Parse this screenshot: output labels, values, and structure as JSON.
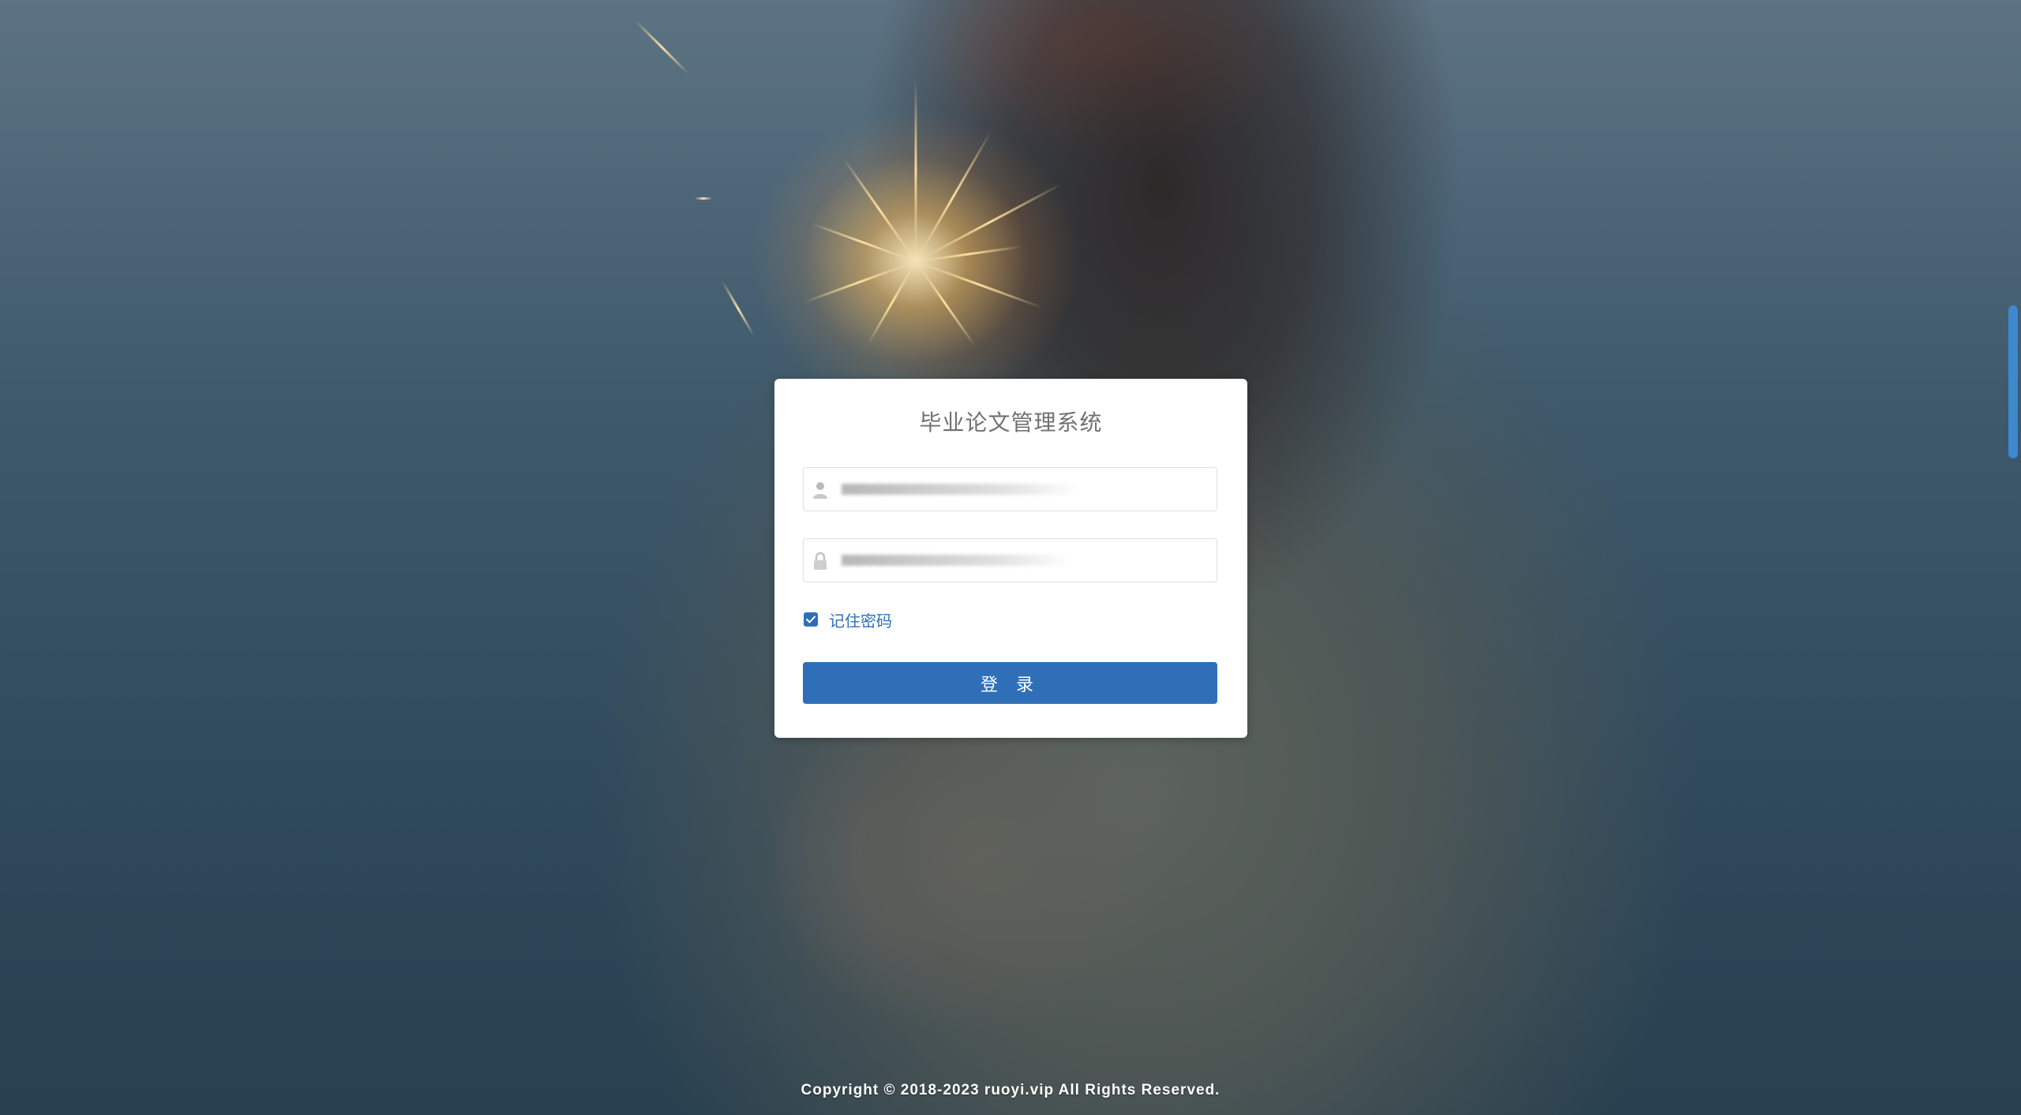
{
  "login": {
    "title": "毕业论文管理系统",
    "username": {
      "value": "",
      "placeholder": ""
    },
    "password": {
      "value": "",
      "placeholder": ""
    },
    "remember_checked": true,
    "remember_label": "记住密码",
    "submit_label": "登 录"
  },
  "footer": {
    "copyright": "Copyright © 2018-2023 ruoyi.vip All Rights Reserved."
  },
  "colors": {
    "accent": "#2f6fb8",
    "card_background": "#ffffff",
    "title_text": "#707070"
  },
  "icons": {
    "username": "user-icon",
    "password": "lock-icon",
    "checkbox": "check-icon"
  }
}
